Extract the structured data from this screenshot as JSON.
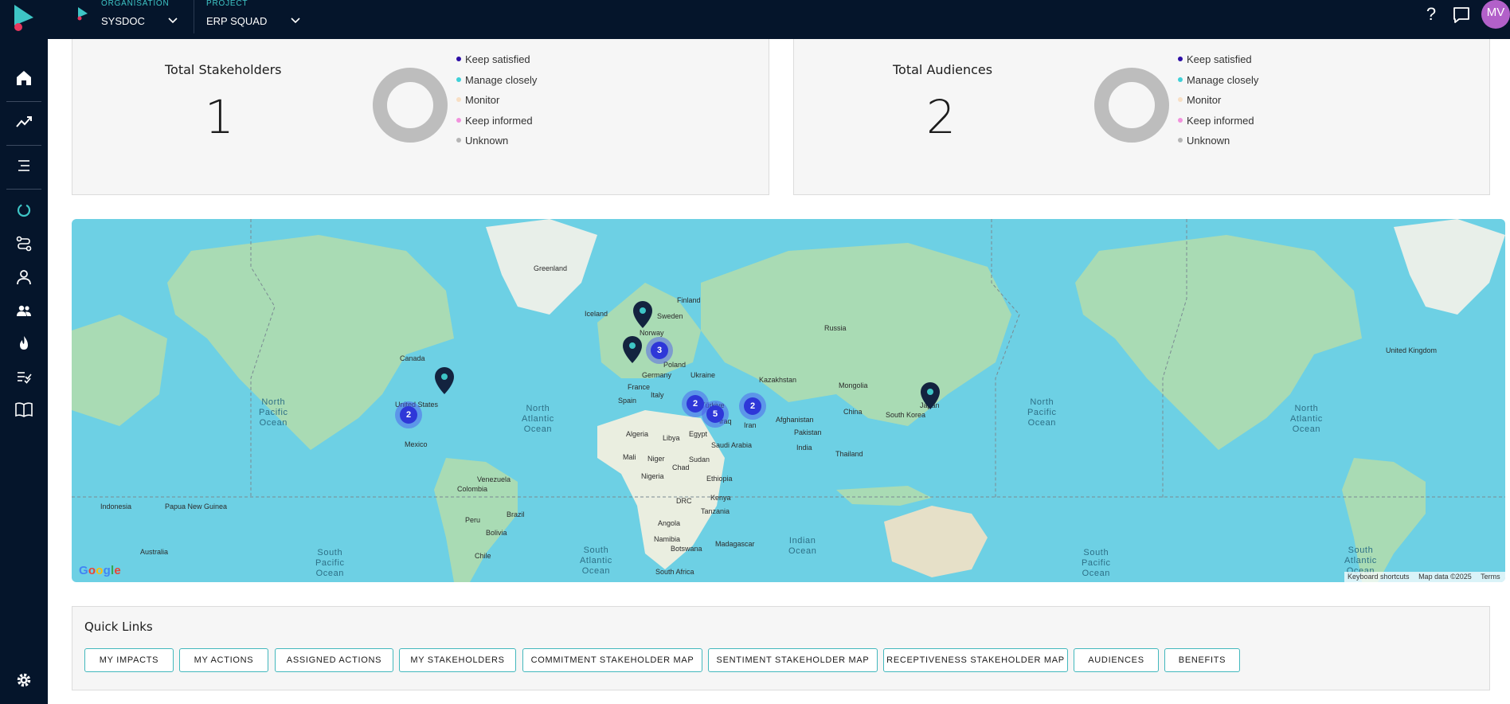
{
  "topbar": {
    "organisation_caption": "ORGANISATION",
    "organisation_value": "SYSDOC",
    "project_caption": "PROJECT",
    "project_value": "ERP SQUAD",
    "help_label": "?",
    "user_initials": "MV"
  },
  "sidebar": {
    "items": [
      "home-icon",
      "trend-icon",
      "list-icon",
      "impacts-icon",
      "journey-icon",
      "person-icon",
      "people-icon",
      "flame-icon",
      "checklist-icon",
      "book-icon",
      "settings-icon"
    ],
    "active": "impacts-icon",
    "accent": "#3ec5c6"
  },
  "stakeholders_card": {
    "title": "Total Stakeholders",
    "value": "1",
    "legend": [
      {
        "label": "Keep satisfied",
        "color": "#2d0ea6"
      },
      {
        "label": "Manage closely",
        "color": "#3ed0d8"
      },
      {
        "label": "Monitor",
        "color": "#f8dfc4"
      },
      {
        "label": "Keep informed",
        "color": "#f292dd"
      },
      {
        "label": "Unknown",
        "color": "#b5b5b5"
      }
    ]
  },
  "audiences_card": {
    "title": "Total Audiences",
    "value": "2",
    "legend": [
      {
        "label": "Keep satisfied",
        "color": "#2d0ea6"
      },
      {
        "label": "Manage closely",
        "color": "#3ed0d8"
      },
      {
        "label": "Monitor",
        "color": "#f8dfc4"
      },
      {
        "label": "Keep informed",
        "color": "#f292dd"
      },
      {
        "label": "Unknown",
        "color": "#b5b5b5"
      }
    ]
  },
  "map": {
    "countries": [
      "Greenland",
      "Iceland",
      "Sweden",
      "Finland",
      "Norway",
      "Russia",
      "Canada",
      "United States",
      "Mexico",
      "Germany",
      "Poland",
      "Ukraine",
      "France",
      "Spain",
      "Italy",
      "Kazakhstan",
      "Mongolia",
      "China",
      "South Korea",
      "Japan",
      "Türkiye",
      "Iraq",
      "Iran",
      "Afghanistan",
      "Pakistan",
      "India",
      "Thailand",
      "Algeria",
      "Libya",
      "Egypt",
      "Saudi Arabia",
      "Mali",
      "Niger",
      "Chad",
      "Sudan",
      "Nigeria",
      "Ethiopia",
      "Kenya",
      "DRC",
      "Tanzania",
      "Angola",
      "Namibia",
      "Botswana",
      "Madagascar",
      "South Africa",
      "Venezuela",
      "Colombia",
      "Peru",
      "Brazil",
      "Bolivia",
      "Chile",
      "Indonesia",
      "Papua New Guinea",
      "Australia",
      "United Kingdom"
    ],
    "oceans": [
      "North\nPacific\nOcean",
      "North\nAtlantic\nOcean",
      "South\nPacific\nOcean",
      "South\nAtlantic\nOcean",
      "Indian\nOcean"
    ],
    "clusters": [
      "2",
      "3",
      "2",
      "5",
      "2"
    ],
    "google_logo": "Google",
    "attribution": [
      "Keyboard shortcuts",
      "Map data ©2025",
      "Terms"
    ]
  },
  "quick_links": {
    "title": "Quick Links",
    "buttons": [
      "MY IMPACTS",
      "MY ACTIONS",
      "ASSIGNED ACTIONS",
      "MY STAKEHOLDERS",
      "COMMITMENT STAKEHOLDER MAP",
      "SENTIMENT STAKEHOLDER MAP",
      "RECEPTIVENESS STAKEHOLDER MAP",
      "AUDIENCES",
      "BENEFITS"
    ]
  }
}
